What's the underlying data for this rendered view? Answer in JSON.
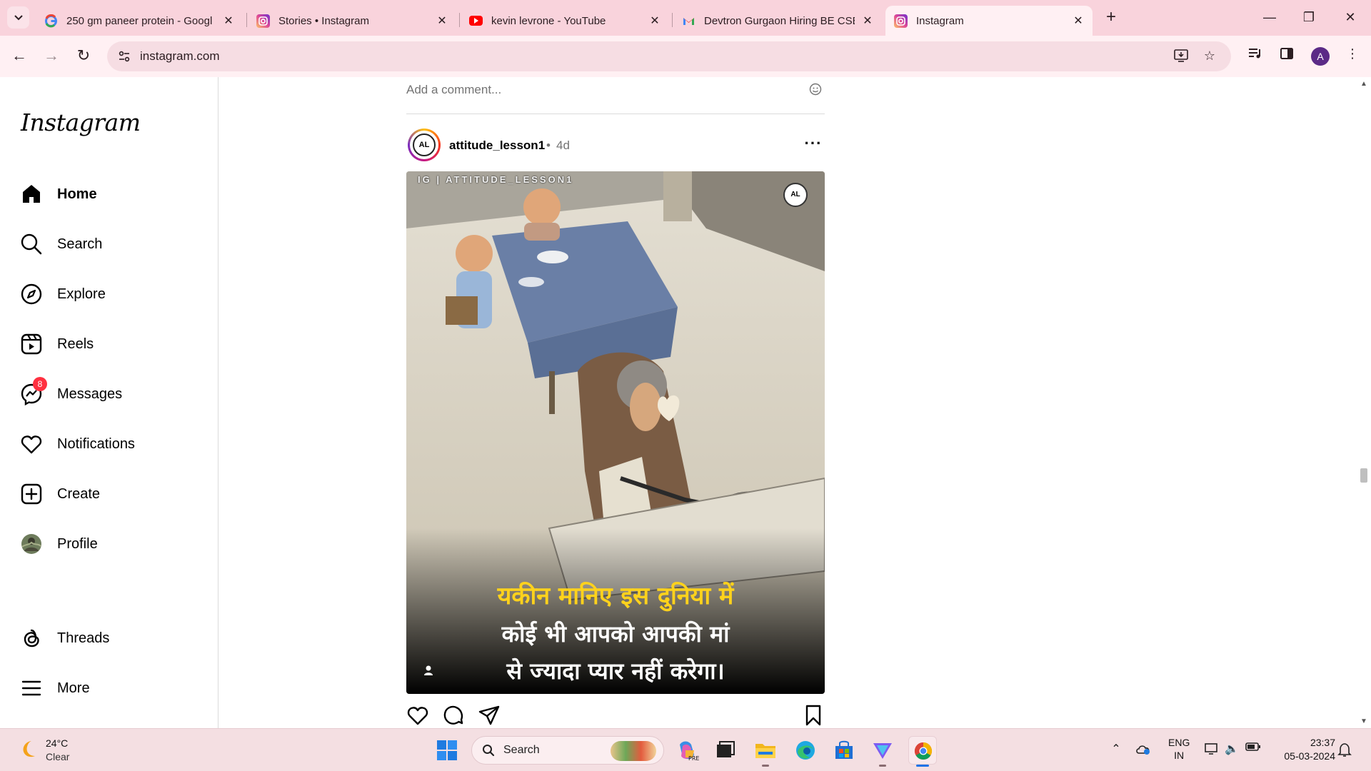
{
  "browser": {
    "tabs": [
      {
        "label": "250 gm paneer protein - Googl",
        "icon": "google-icon"
      },
      {
        "label": "Stories • Instagram",
        "icon": "instagram-icon"
      },
      {
        "label": "kevin levrone - YouTube",
        "icon": "youtube-icon"
      },
      {
        "label": "Devtron Gurgaon Hiring BE CSE",
        "icon": "gmail-icon"
      },
      {
        "label": "Instagram",
        "icon": "instagram-icon",
        "active": true
      }
    ],
    "new_tab": "+",
    "url": "instagram.com",
    "profile_initial": "A",
    "theme_color": "#f9d3dc"
  },
  "sidebar": {
    "logo": "Instagram",
    "items": [
      {
        "label": "Home",
        "icon": "home-icon",
        "active": true
      },
      {
        "label": "Search",
        "icon": "search-icon"
      },
      {
        "label": "Explore",
        "icon": "compass-icon"
      },
      {
        "label": "Reels",
        "icon": "reels-icon"
      },
      {
        "label": "Messages",
        "icon": "messenger-icon",
        "badge": "8"
      },
      {
        "label": "Notifications",
        "icon": "heart-icon"
      },
      {
        "label": "Create",
        "icon": "plus-square-icon"
      },
      {
        "label": "Profile",
        "icon": "profile-avatar"
      }
    ],
    "bottom_items": [
      {
        "label": "Threads",
        "icon": "threads-icon"
      },
      {
        "label": "More",
        "icon": "menu-icon"
      }
    ]
  },
  "feed": {
    "comment_placeholder": "Add a comment...",
    "post": {
      "username": "attitude_lesson1",
      "separator": "•",
      "time": "4d",
      "avatar_text": "AL",
      "image": {
        "tag": "IG | ATTITUDE_LESSON1",
        "logo_text": "AL",
        "caption_lines": [
          "यकीन मानिए इस दुनिया में",
          "कोई भी आपको आपकी मां",
          "से ज्यादा प्यार नहीं करेगा।"
        ]
      }
    }
  },
  "taskbar": {
    "weather": {
      "temp": "24°C",
      "desc": "Clear"
    },
    "search_label": "Search",
    "lang": [
      "ENG",
      "IN"
    ],
    "time": "23:37",
    "date": "05-03-2024"
  }
}
